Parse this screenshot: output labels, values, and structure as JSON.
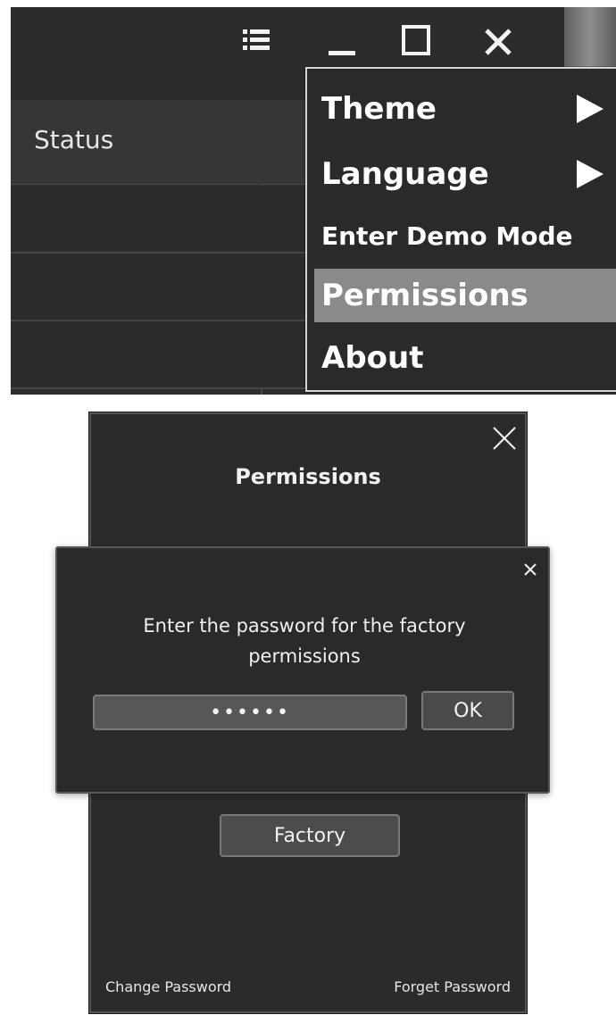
{
  "top_window": {
    "table_header": "Status",
    "icons": {
      "menu": "menu-icon",
      "minimize": "minimize-icon",
      "maximize": "maximize-icon",
      "close": "close-icon"
    }
  },
  "dropdown_menu": {
    "items": [
      {
        "label": "Theme"
      },
      {
        "label": "Language"
      },
      {
        "label": "Enter Demo Mode"
      },
      {
        "label": "Permissions"
      },
      {
        "label": "About"
      }
    ]
  },
  "permissions_window": {
    "title": "Permissions",
    "factory_button": "Factory",
    "change_password": "Change Password",
    "forget_password": "Forget Password"
  },
  "password_dialog": {
    "prompt": "Enter the password for the factory permissions",
    "password_value": "••••••",
    "ok_label": "OK"
  },
  "colors": {
    "window_background": "#2b2b2b",
    "menu_highlight": "#8a8a8a",
    "button_background": "#4a4a4a",
    "text_light": "#f2f2f2"
  }
}
